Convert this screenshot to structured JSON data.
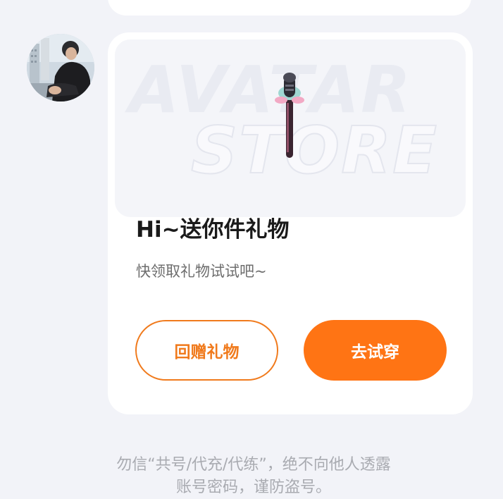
{
  "banner": {
    "line1": "AVATAR",
    "line2": "STORE"
  },
  "gift_card": {
    "title": "Hi~送你件礼物",
    "subtitle": "快领取礼物试试吧~",
    "return_gift_label": "回赠礼物",
    "try_on_label": "去试穿"
  },
  "notice": {
    "line1": "勿信“共号/代充/代练”，绝不向他人透露",
    "line2": "账号密码，谨防盗号。"
  },
  "colors": {
    "accent": "#ff7414",
    "accent_outline": "#f07a1c",
    "background": "#f2f3f8",
    "card": "#ffffff"
  }
}
